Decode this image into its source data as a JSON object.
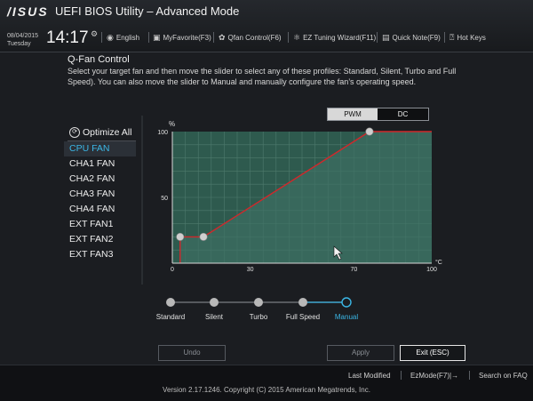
{
  "header": {
    "logo": "/ISUS",
    "title": "UEFI BIOS Utility – Advanced Mode",
    "date": "08/04/2015",
    "day": "Tuesday",
    "time": "14:17",
    "tools": [
      {
        "icon": "globe-icon",
        "label": "English"
      },
      {
        "icon": "favorite-icon",
        "label": "MyFavorite(F3)"
      },
      {
        "icon": "fan-icon",
        "label": "Qfan Control(F6)"
      },
      {
        "icon": "wizard-icon",
        "label": "EZ Tuning Wizard(F11)"
      },
      {
        "icon": "note-icon",
        "label": "Quick Note(F9)"
      },
      {
        "icon": "help-icon",
        "label": "Hot Keys"
      }
    ]
  },
  "page": {
    "heading": "Q-Fan Control",
    "description": "Select your target fan and then move the slider to select any of these profiles: Standard, Silent, Turbo and Full Speed). You can also move the slider to Manual and manually configure the fan’s operating speed."
  },
  "mode_toggle": {
    "options": [
      "PWM",
      "DC"
    ],
    "selected": "PWM"
  },
  "sidebar": {
    "optimize_label": "Optimize All",
    "fans": [
      "CPU FAN",
      "CHA1 FAN",
      "CHA2 FAN",
      "CHA3 FAN",
      "CHA4 FAN",
      "EXT FAN1",
      "EXT FAN2",
      "EXT FAN3"
    ],
    "selected_fan": "CPU FAN"
  },
  "chart_data": {
    "type": "line",
    "title": "",
    "ylabel": "%",
    "xlabel": "°C",
    "xlim": [
      0,
      100
    ],
    "ylim": [
      0,
      100
    ],
    "x_ticks": [
      0,
      30,
      70,
      100
    ],
    "y_ticks": [
      50,
      100
    ],
    "grid": true,
    "series": [
      {
        "x": [
          3,
          3,
          12,
          76,
          100
        ],
        "y": [
          0,
          20,
          20,
          100,
          100
        ],
        "control_points": [
          [
            3,
            20
          ],
          [
            12,
            20
          ],
          [
            76,
            100
          ]
        ]
      }
    ],
    "colors": {
      "fill": "#2f5a4e",
      "line": "#d0282b",
      "point": "#cfcfcf",
      "grid": "#4e7a6d"
    }
  },
  "profiles": {
    "options": [
      "Standard",
      "Silent",
      "Turbo",
      "Full Speed",
      "Manual"
    ],
    "selected": "Manual"
  },
  "buttons": {
    "undo": "Undo",
    "apply": "Apply",
    "exit": "Exit (ESC)"
  },
  "footer": {
    "last_modified": "Last Modified",
    "ezmode": "EzMode(F7)|→",
    "faq": "Search on FAQ",
    "version": "Version 2.17.1246. Copyright (C) 2015 American Megatrends, Inc."
  },
  "colors": {
    "accent": "#3bb7e6",
    "background": "#1b1d21"
  }
}
